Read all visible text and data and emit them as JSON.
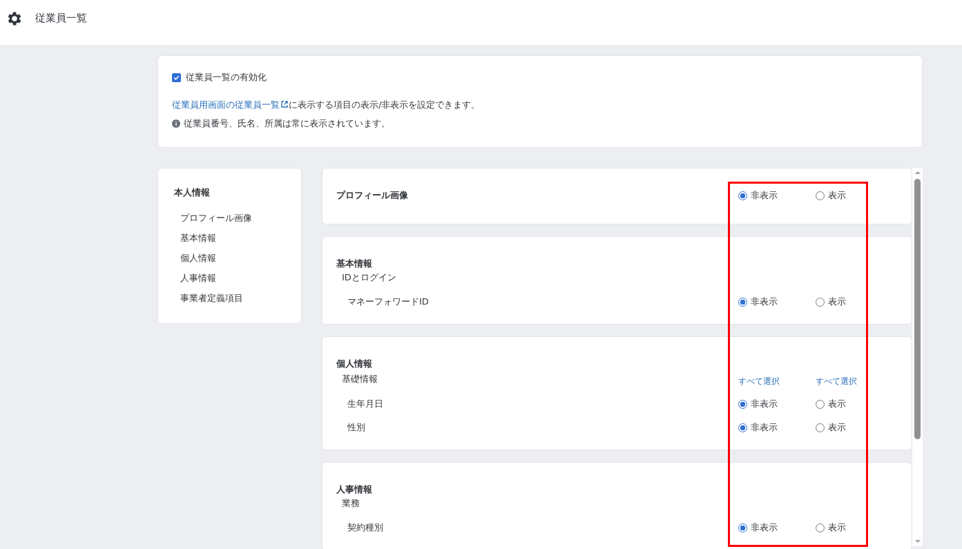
{
  "header": {
    "title": "従業員一覧"
  },
  "settings": {
    "enable": {
      "label": "従業員一覧の有効化",
      "checked": true
    },
    "description": {
      "link": "従業員用画面の従業員一覧",
      "text": "に表示する項目の表示/非表示を設定できます。"
    },
    "note": "従業員番号、氏名、所属は常に表示されています。"
  },
  "sidebar": {
    "title": "本人情報",
    "items": [
      "プロフィール画像",
      "基本情報",
      "個人情報",
      "人事情報",
      "事業者定義項目"
    ]
  },
  "sections": [
    {
      "title": "プロフィール画像",
      "options": [
        {
          "label": "非表示",
          "selected": true
        },
        {
          "label": "表示",
          "selected": false
        }
      ]
    },
    {
      "title": "基本情報",
      "groups": [
        {
          "title": "IDとログイン",
          "rows": [
            {
              "label": "マネーフォワードID",
              "options": [
                {
                  "label": "非表示",
                  "selected": true
                },
                {
                  "label": "表示",
                  "selected": false
                }
              ]
            }
          ]
        }
      ]
    },
    {
      "title": "個人情報",
      "groups": [
        {
          "title": "基礎情報",
          "select_all": [
            "すべて選択",
            "すべて選択"
          ],
          "rows": [
            {
              "label": "生年月日",
              "options": [
                {
                  "label": "非表示",
                  "selected": true
                },
                {
                  "label": "表示",
                  "selected": false
                }
              ]
            },
            {
              "label": "性別",
              "options": [
                {
                  "label": "非表示",
                  "selected": true
                },
                {
                  "label": "表示",
                  "selected": false
                }
              ]
            }
          ]
        }
      ]
    },
    {
      "title": "人事情報",
      "groups": [
        {
          "title": "業務",
          "rows": [
            {
              "label": "契約種別",
              "options": [
                {
                  "label": "非表示",
                  "selected": true
                },
                {
                  "label": "表示",
                  "selected": false
                }
              ]
            }
          ]
        }
      ]
    }
  ]
}
